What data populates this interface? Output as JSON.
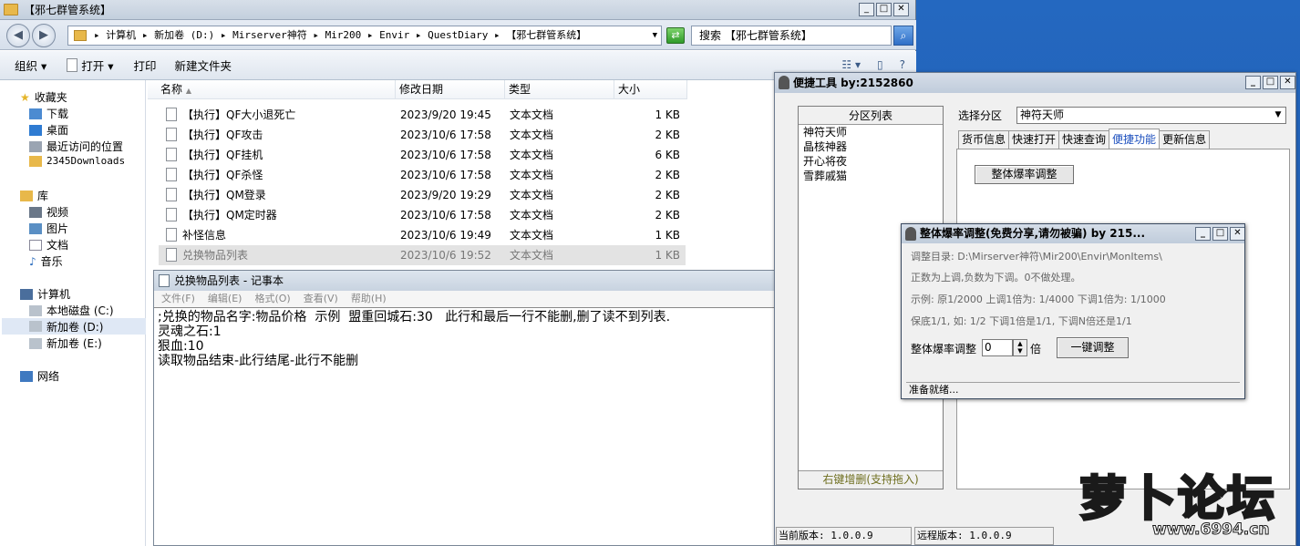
{
  "explorer": {
    "title": "【邪七群管系统】",
    "address": "▸ 计算机 ▸ 新加卷 (D:) ▸ Mirserver神符 ▸ Mir200 ▸ Envir ▸ QuestDiary ▸ 【邪七群管系统】",
    "search_placeholder": "搜索 【邪七群管系统】",
    "toolbar": {
      "organize": "组织 ▾",
      "open": "打开 ▾",
      "print": "打印",
      "new_folder": "新建文件夹"
    },
    "nav": {
      "favorites": "收藏夹",
      "downloads": "下载",
      "desktop": "桌面",
      "recent": "最近访问的位置",
      "d2345": "2345Downloads",
      "library": "库",
      "videos": "视频",
      "pictures": "图片",
      "documents": "文档",
      "music": "音乐",
      "computer": "计算机",
      "local_c": "本地磁盘 (C:)",
      "new_d": "新加卷 (D:)",
      "new_e": "新加卷 (E:)",
      "network": "网络"
    },
    "columns": {
      "name": "名称",
      "modified": "修改日期",
      "type": "类型",
      "size": "大小"
    },
    "files": [
      {
        "name": "【执行】QF大小退死亡",
        "date": "2023/9/20 19:45",
        "type": "文本文档",
        "size": "1 KB"
      },
      {
        "name": "【执行】QF攻击",
        "date": "2023/10/6 17:58",
        "type": "文本文档",
        "size": "2 KB"
      },
      {
        "name": "【执行】QF挂机",
        "date": "2023/10/6 17:58",
        "type": "文本文档",
        "size": "6 KB"
      },
      {
        "name": "【执行】QF杀怪",
        "date": "2023/10/6 17:58",
        "type": "文本文档",
        "size": "2 KB"
      },
      {
        "name": "【执行】QM登录",
        "date": "2023/9/20 19:29",
        "type": "文本文档",
        "size": "2 KB"
      },
      {
        "name": "【执行】QM定时器",
        "date": "2023/10/6 17:58",
        "type": "文本文档",
        "size": "2 KB"
      },
      {
        "name": "补怪信息",
        "date": "2023/10/6 19:49",
        "type": "文本文档",
        "size": "1 KB"
      },
      {
        "name": "兑换物品列表",
        "date": "2023/10/6 19:52",
        "type": "文本文档",
        "size": "1 KB"
      }
    ]
  },
  "notepad": {
    "title": "兑换物品列表 - 记事本",
    "menu": [
      "文件(F)",
      "编辑(E)",
      "格式(O)",
      "查看(V)",
      "帮助(H)"
    ],
    "lines": [
      ";兑换的物品名字:物品价格  示例  盟重回城石:30   此行和最后一行不能删,删了读不到列表.",
      "灵魂之石:1",
      "狠血:10",
      "读取物品结束-此行结尾-此行不能删"
    ]
  },
  "tool": {
    "title": "便捷工具  by:2152860",
    "group_header": "分区列表",
    "groups": [
      "神符天师",
      "晶核神器",
      "开心将夜",
      "雪葬戚猫"
    ],
    "group_footer": "右键增删(支持拖入)",
    "select_label": "选择分区",
    "selected": "神符天师",
    "tabs": [
      "货币信息",
      "快速打开",
      "快速查询",
      "便捷功能",
      "更新信息"
    ],
    "adjust_button": "整体爆率调整",
    "current_version": "当前版本: 1.0.0.9",
    "remote_version": "远程版本: 1.0.0.9"
  },
  "dialog": {
    "title": "整体爆率调整(免费分享,请勿被骗)  by 215...",
    "dir": "调整目录: D:\\Mirserver神符\\Mir200\\Envir\\MonItems\\",
    "info1": "正数为上调,负数为下调。0不做处理。",
    "info2": "示例: 原1/2000 上调1倍为: 1/4000 下调1倍为: 1/1000",
    "info3": "保底1/1, 如: 1/2 下调1倍是1/1, 下调N倍还是1/1",
    "field_label": "整体爆率调整",
    "value": "0",
    "unit": "倍",
    "button": "一键调整",
    "status": "准备就绪..."
  },
  "logo": {
    "text": "萝卜论坛",
    "url": "www.6994.cn"
  }
}
